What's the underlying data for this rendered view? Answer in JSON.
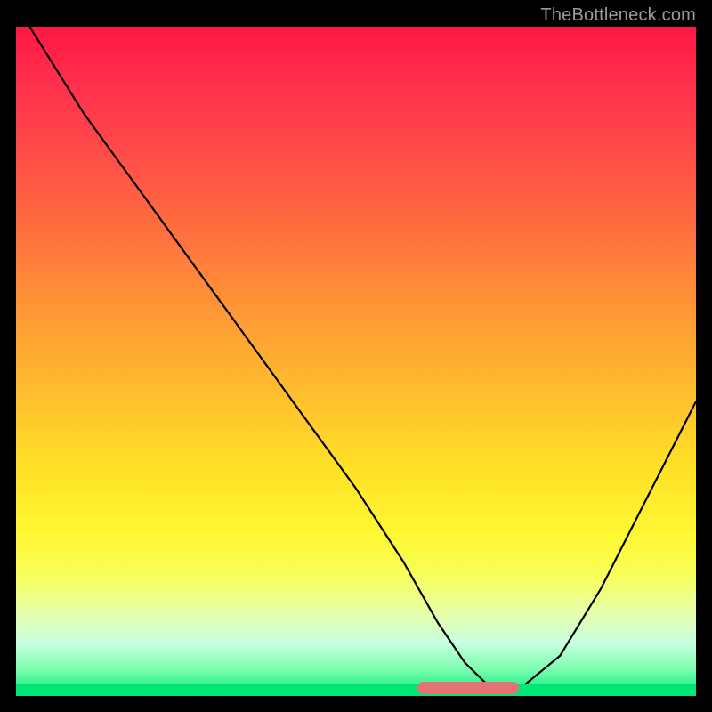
{
  "watermark": "TheBottleneck.com",
  "chart_data": {
    "type": "line",
    "title": "",
    "xlabel": "",
    "ylabel": "",
    "xlim": [
      0,
      100
    ],
    "ylim": [
      0,
      100
    ],
    "series": [
      {
        "name": "curve",
        "x": [
          2,
          10,
          20,
          30,
          40,
          50,
          57,
          62,
          66,
          70,
          74,
          80,
          86,
          92,
          100
        ],
        "y": [
          100,
          87,
          73,
          59,
          45,
          31,
          20,
          11,
          5,
          1,
          1,
          6,
          16,
          28,
          44
        ]
      }
    ],
    "highlight_region": {
      "x_start": 59,
      "x_end": 74,
      "color": "#e57373"
    },
    "gradient_stops": [
      "#ff1744",
      "#ffeb3b",
      "#00e676"
    ]
  }
}
